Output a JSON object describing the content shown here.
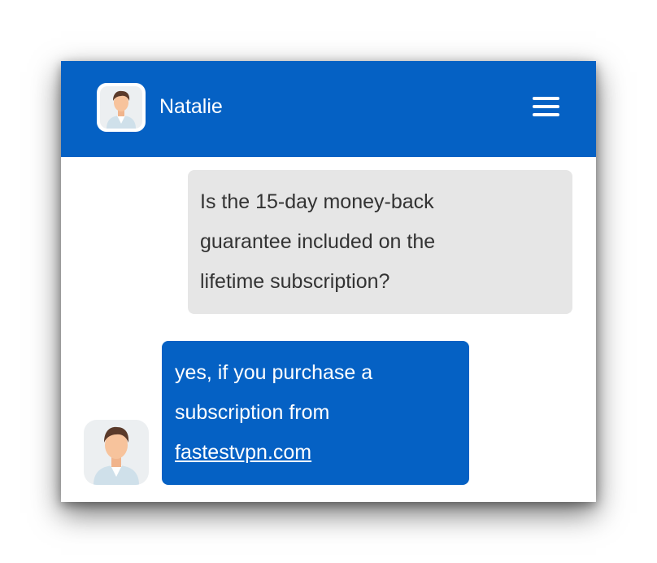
{
  "header": {
    "name": "Natalie",
    "avatar_icon": "person-avatar-icon",
    "menu_icon": "hamburger-menu-icon",
    "background_color": "#0561c4"
  },
  "messages": [
    {
      "sender": "user",
      "lines": [
        "Is the 15-day money-back",
        "guarantee included on the",
        "lifetime subscription?"
      ],
      "bubble_color": "#e6e6e6"
    },
    {
      "sender": "agent",
      "lines": [
        "yes, if you purchase a",
        "subscription from"
      ],
      "link_text": "fastestvpn.com",
      "bubble_color": "#0561c4"
    }
  ]
}
